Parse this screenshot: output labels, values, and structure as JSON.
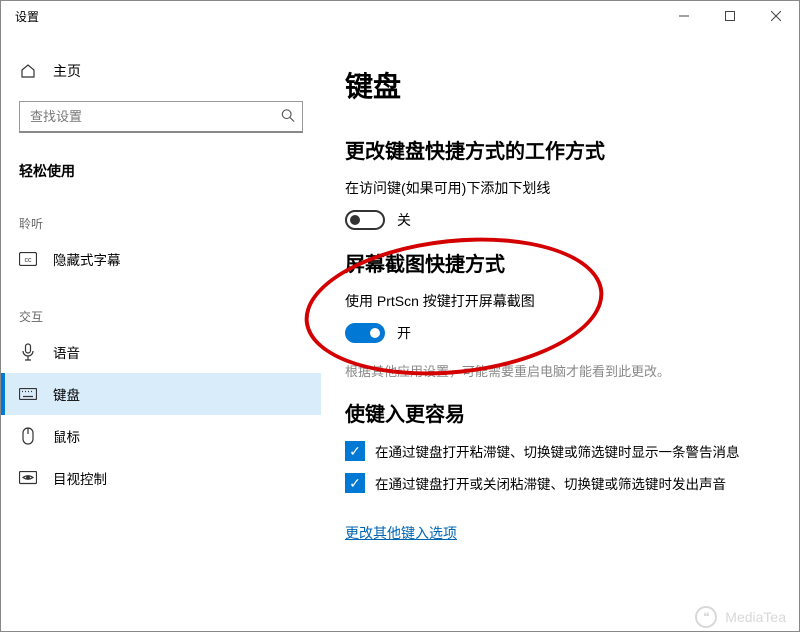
{
  "window": {
    "title": "设置"
  },
  "sidebar": {
    "home_label": "主页",
    "search_placeholder": "查找设置",
    "category_title": "轻松使用",
    "section_hearing": "聆听",
    "section_interaction": "交互",
    "nav": {
      "captions": "隐藏式字幕",
      "speech": "语音",
      "keyboard": "键盘",
      "mouse": "鼠标",
      "eye_control": "目视控制"
    }
  },
  "content": {
    "page_title": "键盘",
    "section1": {
      "heading": "更改键盘快捷方式的工作方式",
      "label": "在访问键(如果可用)下添加下划线",
      "state_label": "关"
    },
    "section2": {
      "heading": "屏幕截图快捷方式",
      "label": "使用 PrtScn 按键打开屏幕截图",
      "state_label": "开",
      "hint": "根据其他应用设置，可能需要重启电脑才能看到此更改。"
    },
    "section3": {
      "heading": "使键入更容易",
      "check1": "在通过键盘打开粘滞键、切换键或筛选键时显示一条警告消息",
      "check2": "在通过键盘打开或关闭粘滞键、切换键或筛选键时发出声音",
      "link": "更改其他键入选项"
    }
  },
  "watermark": "MediaTea"
}
